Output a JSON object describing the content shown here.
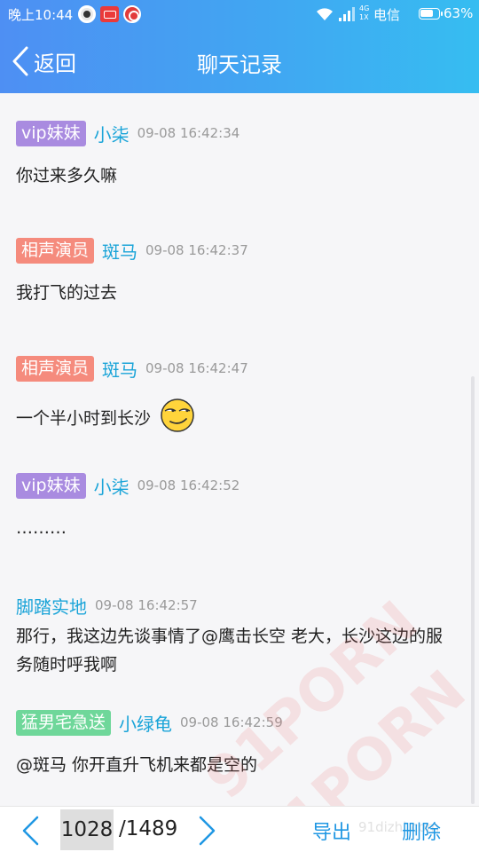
{
  "status_bar": {
    "time": "晚上10:44",
    "network": "4G\n1X",
    "carrier": "电信",
    "battery_percent": "63%",
    "battery_level": 0.63
  },
  "nav": {
    "back_label": "返回",
    "title": "聊天记录"
  },
  "messages": [
    {
      "badge": "vip妹妹",
      "badge_color": "#a98be0",
      "nick": "小柒",
      "time": "09-08 16:42:34",
      "text": "你过来多久嘛"
    },
    {
      "badge": "相声演员",
      "badge_color": "#f58b7d",
      "nick": "斑马",
      "time": "09-08 16:42:37",
      "text": "我打飞的过去"
    },
    {
      "badge": "相声演员",
      "badge_color": "#f58b7d",
      "nick": "斑马",
      "time": "09-08 16:42:47",
      "text": "一个半小时到长沙",
      "emoji": "smirk-emoji-icon"
    },
    {
      "badge": "vip妹妹",
      "badge_color": "#a98be0",
      "nick": "小柒",
      "time": "09-08 16:42:52",
      "text": "………"
    },
    {
      "nick": "脚踏实地",
      "time": "09-08 16:42:57",
      "text": "那行，我这边先谈事情了@鹰击长空 老大，长沙这边的服务随时呼我啊"
    },
    {
      "badge": "猛男宅急送",
      "badge_color": "#6fd79a",
      "nick": "小绿龟",
      "time": "09-08 16:42:59",
      "text": "@斑马 你开直升飞机来都是空的"
    }
  ],
  "watermark": "91PORN",
  "site_watermark": "91dizhi.com",
  "pager": {
    "current_page": "1028",
    "total_pages": "/1489",
    "export_label": "导出",
    "delete_label": "删除"
  },
  "colors": {
    "header_gradient_start": "#4e8ff3",
    "header_gradient_end": "#36bdf1",
    "nick": "#1aa4d8",
    "action": "#1f97e3"
  }
}
